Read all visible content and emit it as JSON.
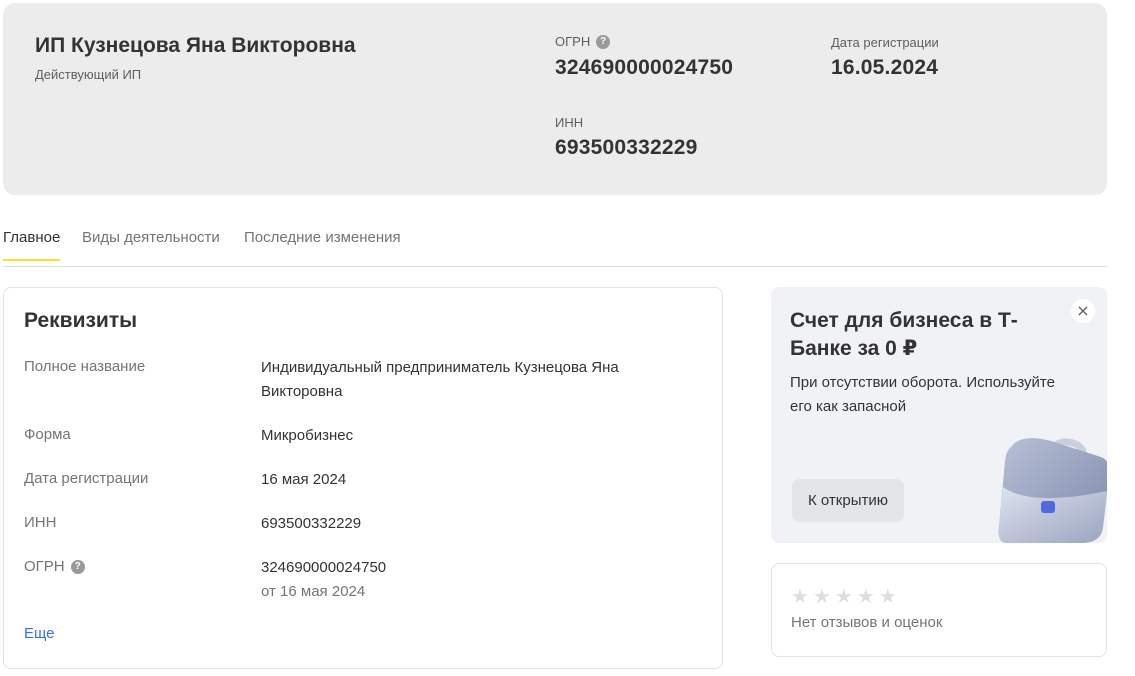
{
  "header": {
    "company_name": "ИП Кузнецова Яна Викторовна",
    "status": "Действующий ИП",
    "ogrn_label": "ОГРН",
    "ogrn_value": "324690000024750",
    "reg_date_label": "Дата регистрации",
    "reg_date_value": "16.05.2024",
    "inn_label": "ИНН",
    "inn_value": "693500332229",
    "help_glyph": "?"
  },
  "tabs": [
    {
      "label": "Главное",
      "active": true
    },
    {
      "label": "Виды деятельности",
      "active": false
    },
    {
      "label": "Последние изменения",
      "active": false
    }
  ],
  "requisites": {
    "title": "Реквизиты",
    "rows": [
      {
        "label": "Полное название",
        "value": "Индивидуальный предприниматель Кузнецова Яна Викторовна"
      },
      {
        "label": "Форма",
        "value": "Микробизнес"
      },
      {
        "label": "Дата регистрации",
        "value": "16 мая 2024"
      },
      {
        "label": "ИНН",
        "value": "693500332229"
      },
      {
        "label": "ОГРН",
        "value": "324690000024750",
        "sub": "от 16 мая 2024"
      }
    ],
    "more_link": "Еще"
  },
  "promo": {
    "title": "Счет для бизнеса в Т-Банке за 0 ₽",
    "text": "При отсутствии оборота. Используйте его как запасной",
    "button_label": "К открытию",
    "close_glyph": "×",
    "illustration_icon": "briefcase-icon"
  },
  "reviews": {
    "star_glyph": "★",
    "rating_stars": 0,
    "max_stars": 5,
    "text": "Нет отзывов и оценок"
  },
  "colors": {
    "accent_tab_underline": "#ffdd2d",
    "link": "#336fee",
    "header_bg": "#ececec",
    "promo_bg": "#f0f2f5"
  }
}
